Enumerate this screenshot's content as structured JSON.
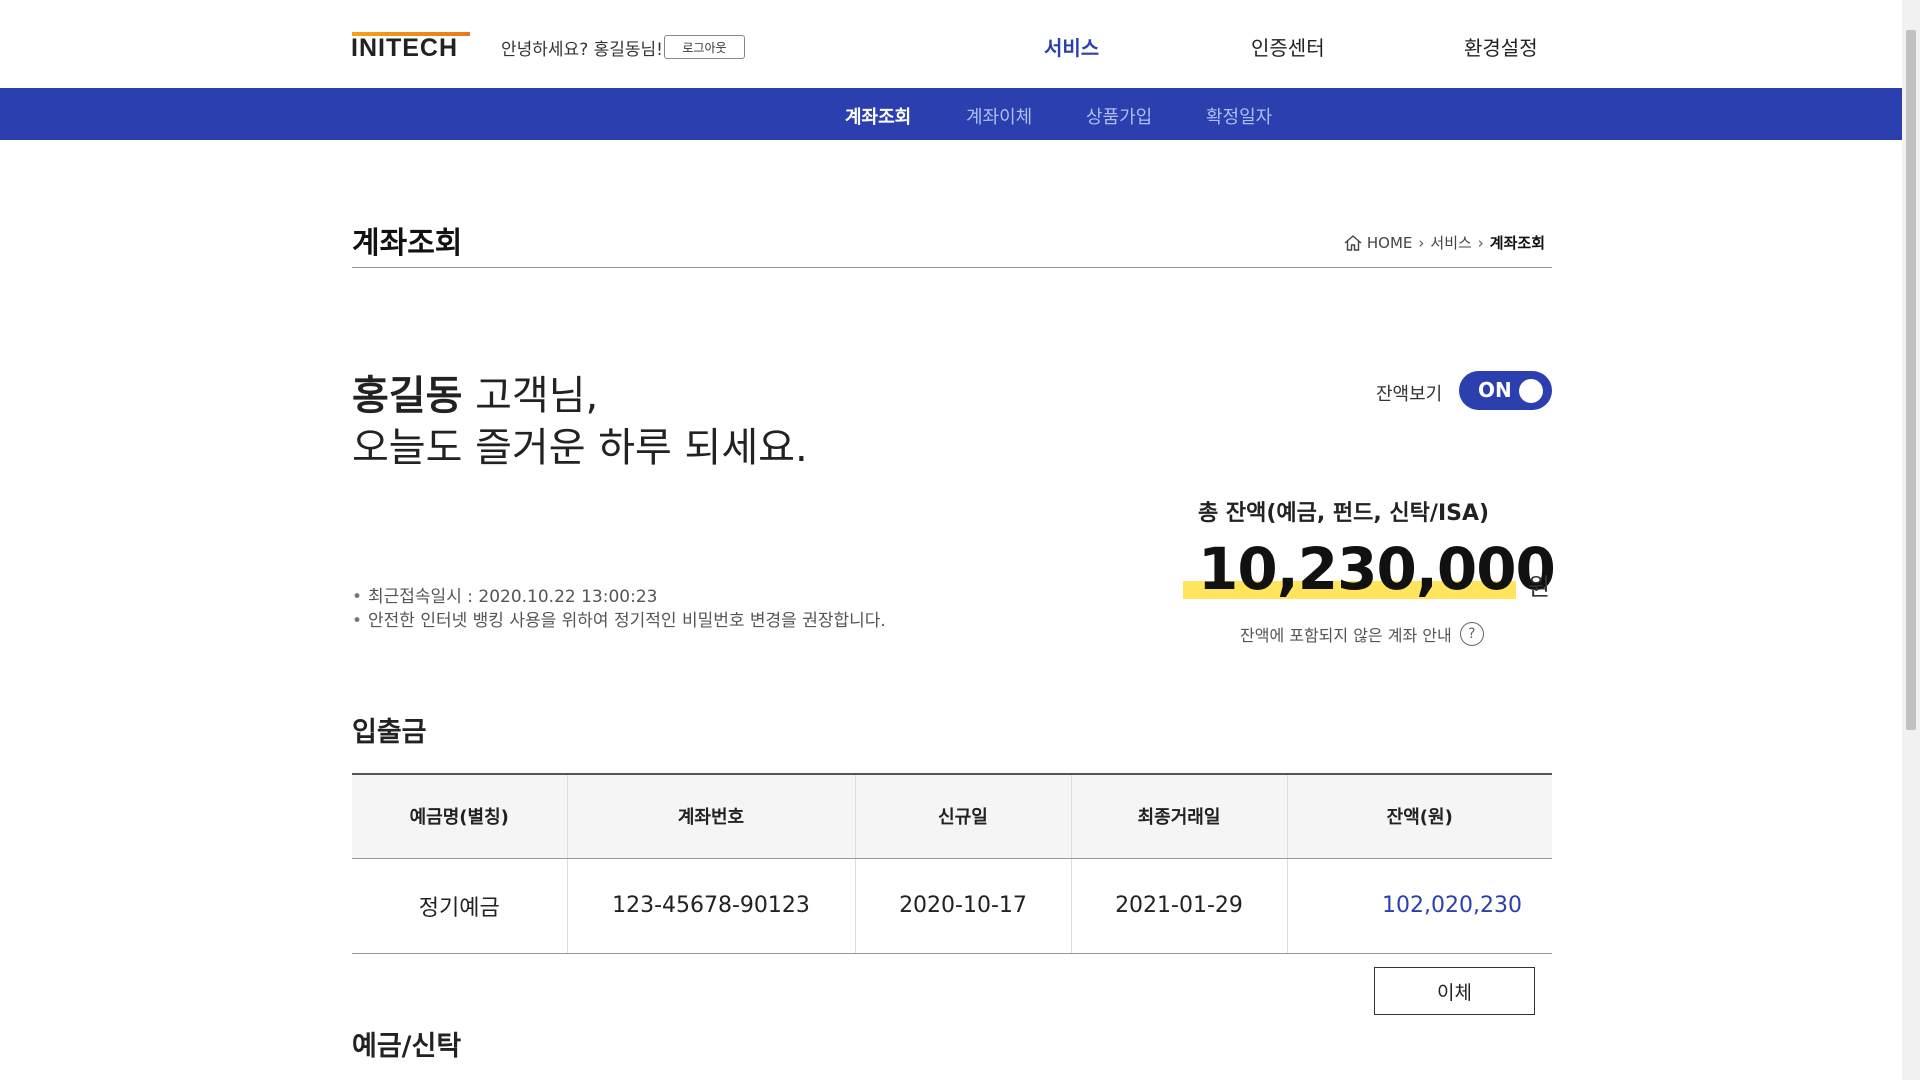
{
  "header": {
    "logo": "INITECH",
    "greeting": "안녕하세요? 홍길동님!",
    "logout_label": "로그아웃",
    "menu": [
      {
        "label": "서비스"
      },
      {
        "label": "인증센터"
      },
      {
        "label": "환경설정"
      }
    ]
  },
  "subnav": {
    "items": [
      {
        "label": "계좌조회"
      },
      {
        "label": "계좌이체"
      },
      {
        "label": "상품가입"
      },
      {
        "label": "확정일자"
      }
    ]
  },
  "page": {
    "title": "계좌조회",
    "breadcrumb": {
      "home": "HOME",
      "level1": "서비스",
      "current": "계좌조회"
    }
  },
  "welcome": {
    "name": "홍길동",
    "honorific": " 고객님,",
    "line2": "오늘도 즐거운 하루 되세요."
  },
  "notes": {
    "last_login": "최근접속일시 : 2020.10.22 13:00:23",
    "advice": "안전한 인터넷 뱅킹 사용을 위하여 정기적인 비밀번호 변경을 권장합니다."
  },
  "balance": {
    "toggle_label": "잔액보기",
    "toggle_state": "ON",
    "total_label": "총 잔액(예금, 펀드, 신탁/ISA)",
    "total_amount": "10,230,000",
    "unit": "원",
    "excluded_info": "잔액에 포함되지 않은 계좌 안내",
    "help_icon": "?",
    "highlight_color": "#ffe45c"
  },
  "deposit_section": {
    "title": "입출금",
    "columns": [
      "예금명(별칭)",
      "계좌번호",
      "신규일",
      "최종거래일",
      "잔액(원)"
    ],
    "rows": [
      {
        "name": "정기예금",
        "account": "123-45678-90123",
        "opened": "2020-10-17",
        "last_tx": "2021-01-29",
        "balance": "102,020,230"
      }
    ],
    "transfer_label": "이체"
  },
  "trust_section": {
    "title": "예금/신탁"
  },
  "colors": {
    "brand_blue": "#2b3fae",
    "subnav_inactive": "#aebdf2"
  }
}
